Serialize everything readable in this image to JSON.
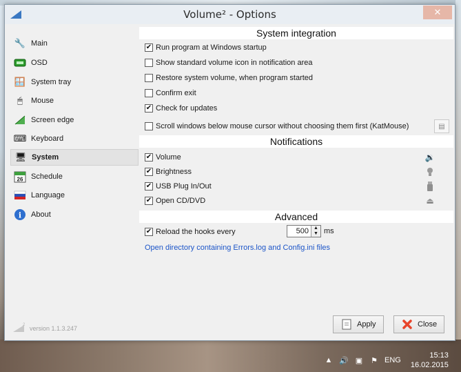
{
  "window": {
    "title": "Volume² - Options",
    "close_glyph": "✕",
    "version": "version 1.1.3.247"
  },
  "sidebar": {
    "items": [
      {
        "label": "Main",
        "icon": "tools-icon",
        "active": false
      },
      {
        "label": "OSD",
        "icon": "osd-icon",
        "active": false
      },
      {
        "label": "System tray",
        "icon": "system-tray-icon",
        "active": false
      },
      {
        "label": "Mouse",
        "icon": "mouse-icon",
        "active": false
      },
      {
        "label": "Screen edge",
        "icon": "screen-edge-icon",
        "active": false
      },
      {
        "label": "Keyboard",
        "icon": "keyboard-icon",
        "active": false
      },
      {
        "label": "System",
        "icon": "system-icon",
        "active": true
      },
      {
        "label": "Schedule",
        "icon": "calendar-icon",
        "calendar_day": "26",
        "active": false
      },
      {
        "label": "Language",
        "icon": "flag-icon",
        "active": false
      },
      {
        "label": "About",
        "icon": "info-icon",
        "active": false
      }
    ]
  },
  "system_integration": {
    "heading": "System integration",
    "options": [
      {
        "label": "Run program at Windows startup",
        "checked": true
      },
      {
        "label": "Show standard volume icon in notification area",
        "checked": false
      },
      {
        "label": "Restore system volume, when program started",
        "checked": false
      },
      {
        "label": "Confirm exit",
        "checked": false
      },
      {
        "label": "Check for updates",
        "checked": true
      },
      {
        "label": "Scroll windows below mouse cursor without choosing them first (KatMouse)",
        "checked": false
      }
    ]
  },
  "notifications": {
    "heading": "Notifications",
    "options": [
      {
        "label": "Volume",
        "checked": true,
        "icon": "speaker-icon"
      },
      {
        "label": "Brightness",
        "checked": true,
        "icon": "bulb-icon"
      },
      {
        "label": "USB Plug In/Out",
        "checked": true,
        "icon": "usb-icon"
      },
      {
        "label": "Open CD/DVD",
        "checked": true,
        "icon": "eject-icon"
      }
    ]
  },
  "advanced": {
    "heading": "Advanced",
    "reload_label": "Reload the hooks every",
    "reload_checked": true,
    "reload_value": "500",
    "unit": "ms",
    "link": "Open directory containing Errors.log and Config.ini files"
  },
  "buttons": {
    "apply": "Apply",
    "close": "Close"
  },
  "taskbar": {
    "language": "ENG",
    "time": "15:13",
    "date": "16.02.2015"
  },
  "colors": {
    "link": "#1c55c8",
    "close_button": "#e6b7a8",
    "close_icon": "#e8442a"
  }
}
